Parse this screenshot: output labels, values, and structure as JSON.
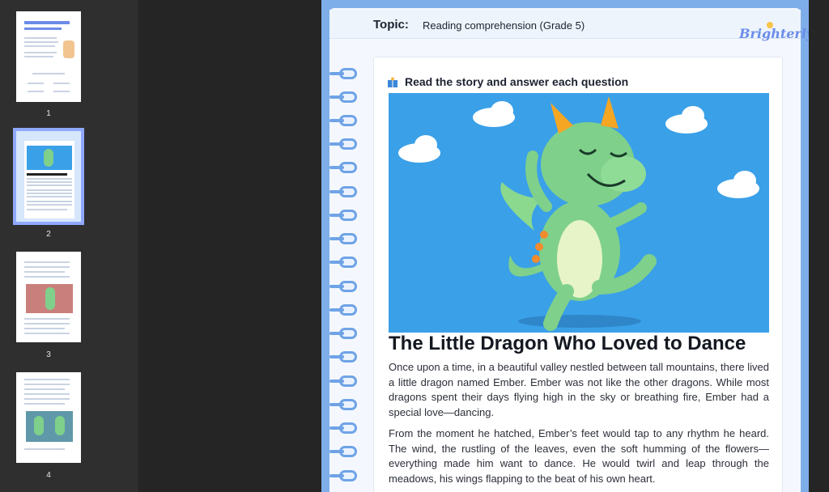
{
  "sidebar": {
    "pages": [
      {
        "number": "1",
        "selected": false
      },
      {
        "number": "2",
        "selected": true
      },
      {
        "number": "3",
        "selected": false
      },
      {
        "number": "4",
        "selected": false
      }
    ]
  },
  "document": {
    "topic_label": "Topic:",
    "topic_value": "Reading comprehension (Grade 5)",
    "brand": "Brighterly",
    "instruction": "Read the story and answer each question",
    "story_title": "The Little Dragon Who Loved to Dance",
    "paragraphs": [
      "Once upon a time, in a beautiful valley nestled between tall mountains, there lived a little dragon named Ember. Ember was not like the other dragons. While most dragons spent their days flying high in the sky or breathing fire, Ember had a special love—dancing.",
      "From the moment he hatched, Ember’s feet would tap to any rhythm he heard. The wind, the rustling of the leaves, even the soft humming of the flowers—everything made him want to dance. He would twirl and leap through the meadows, his wings flapping to the beat of his own heart."
    ]
  },
  "colors": {
    "sky": "#3aa0e8",
    "dragon": "#7fd08a",
    "page_border": "#7eaee9",
    "brand": "#6b8de8"
  },
  "icons": {
    "instruction": "book-icon"
  }
}
